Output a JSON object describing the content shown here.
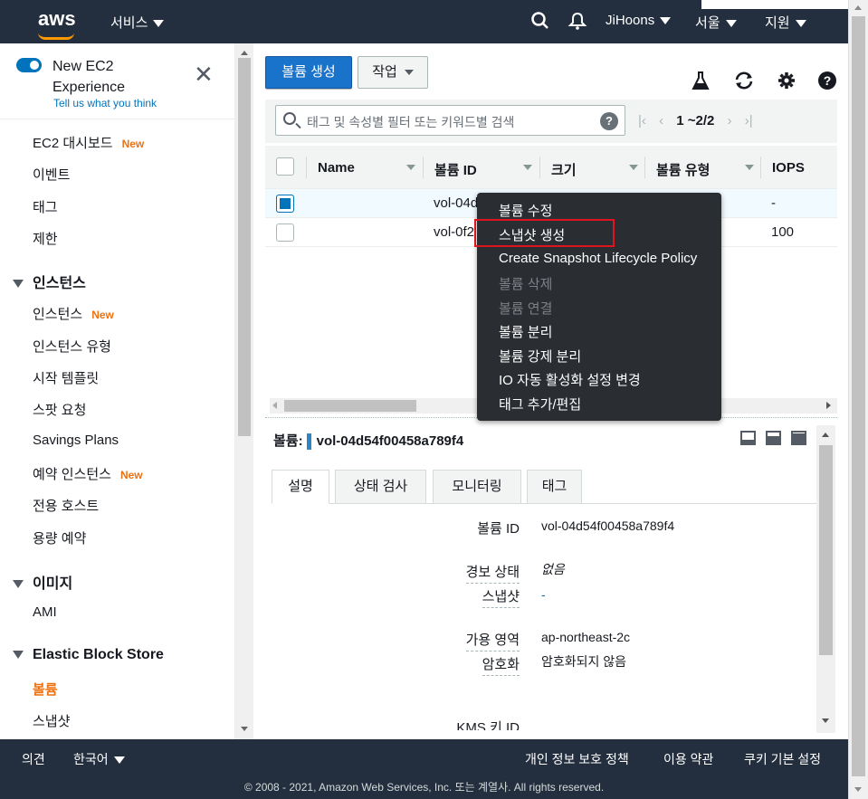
{
  "topnav": {
    "logo": "aws",
    "services": "서비스",
    "user": "JiHoons",
    "region": "서울",
    "support": "지원"
  },
  "sidebar": {
    "new_experience_title": "New EC2 Experience",
    "new_experience_link": "Tell us what you think",
    "new_badge": "New",
    "items_top": [
      {
        "label": "EC2 대시보드",
        "new": true
      },
      {
        "label": "이벤트"
      },
      {
        "label": "태그"
      },
      {
        "label": "제한"
      }
    ],
    "group_instances": "인스턴스",
    "items_instances": [
      {
        "label": "인스턴스",
        "new": true
      },
      {
        "label": "인스턴스 유형"
      },
      {
        "label": "시작 템플릿"
      },
      {
        "label": "스팟 요청"
      },
      {
        "label": "Savings Plans"
      },
      {
        "label": "예약 인스턴스",
        "new": true
      },
      {
        "label": "전용 호스트"
      },
      {
        "label": "용량 예약"
      }
    ],
    "group_images": "이미지",
    "items_images": [
      {
        "label": "AMI"
      }
    ],
    "group_ebs": "Elastic Block Store",
    "items_ebs": [
      {
        "label": "볼륨",
        "active": true
      },
      {
        "label": "스냅샷"
      }
    ]
  },
  "toolbar": {
    "create_volume": "볼륨 생성",
    "actions": "작업"
  },
  "filter": {
    "placeholder": "태그 및 속성별 필터 또는 키워드별 검색",
    "pager": "1 ~2/2"
  },
  "table": {
    "columns": [
      "Name",
      "볼륨 ID",
      "크기",
      "볼륨 유형",
      "IOPS"
    ],
    "rows": [
      {
        "name": "",
        "volume_id": "vol-04d",
        "iops": "-",
        "selected": true
      },
      {
        "name": "",
        "volume_id": "vol-0f2",
        "iops": "100",
        "selected": false
      }
    ]
  },
  "context_menu": {
    "items": [
      {
        "label": "볼륨 수정",
        "disabled": false
      },
      {
        "label": "스냅샷 생성",
        "disabled": false,
        "highlighted": true
      },
      {
        "label": "Create Snapshot Lifecycle Policy",
        "disabled": false
      },
      {
        "label": "볼륨 삭제",
        "disabled": true
      },
      {
        "label": "볼륨 연결",
        "disabled": true
      },
      {
        "label": "볼륨 분리",
        "disabled": false
      },
      {
        "label": "볼륨 강제 분리",
        "disabled": false
      },
      {
        "label": "IO 자동 활성화 설정 변경",
        "disabled": false
      },
      {
        "label": "태그 추가/편집",
        "disabled": false
      }
    ]
  },
  "detail": {
    "title_prefix": "볼륨:",
    "volume_id": "vol-04d54f00458a789f4",
    "tabs": [
      "설명",
      "상태 검사",
      "모니터링",
      "태그"
    ],
    "fields": [
      {
        "label": "볼륨 ID",
        "value": "vol-04d54f00458a789f4"
      },
      {
        "label": "경보 상태",
        "value": "없음"
      },
      {
        "label": "스냅샷",
        "value": "-"
      },
      {
        "label": "가용 영역",
        "value": "ap-northeast-2c"
      },
      {
        "label": "암호화",
        "value": "암호화되지 않음"
      },
      {
        "label": "KMS 키 ID",
        "value": ""
      }
    ]
  },
  "footer": {
    "feedback": "의견",
    "language": "한국어",
    "privacy": "개인 정보 보호 정책",
    "terms": "이용 약관",
    "cookies": "쿠키 기본 설정",
    "copyright": "© 2008 - 2021, Amazon Web Services, Inc. 또는 계열사. All rights reserved."
  }
}
